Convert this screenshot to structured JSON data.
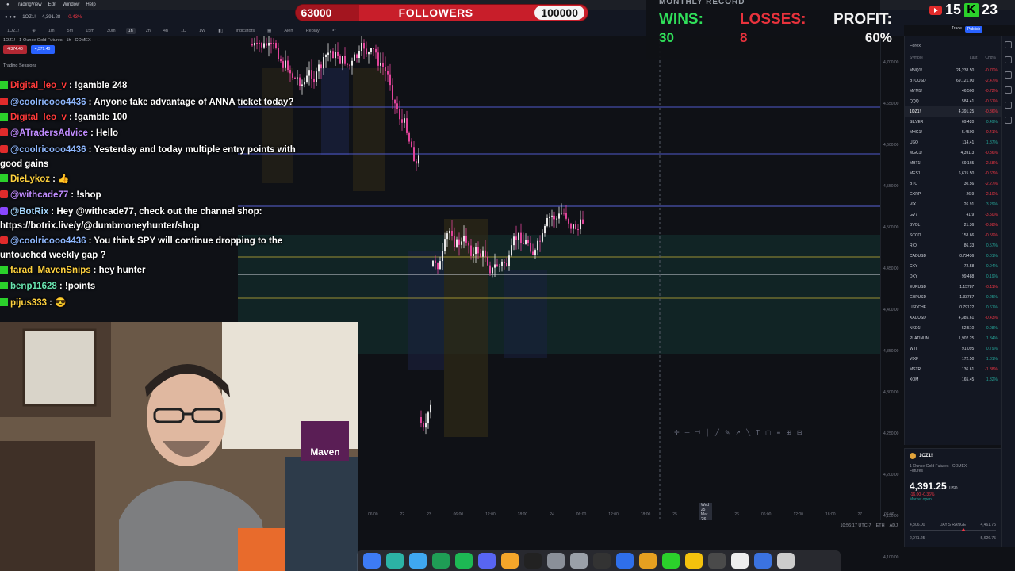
{
  "menubar": {
    "app": "TradingView",
    "items": [
      "Edit",
      "Window",
      "Help"
    ]
  },
  "tv": {
    "symbol": "1OZ1!",
    "price_bar": "4,391.28",
    "change_bar": "-0.43%",
    "description": "1OZ1! · 1-Ounce Gold Futures · 1h · COMEX",
    "indicators_label": "Indicators",
    "alert_label": "Alert",
    "replay_label": "Replay",
    "timeframes": [
      "1m",
      "5m",
      "15m",
      "30m",
      "1h",
      "2h",
      "4h",
      "1D",
      "1W"
    ],
    "active_timeframe": "1h",
    "sessions_label": "Trading Sessions",
    "sell_price": "4,374.40",
    "buy_price": "4,379.40",
    "publish_label": "Publish",
    "trade_label": "Trade"
  },
  "followers": {
    "min": "63000",
    "label": "FOLLOWERS",
    "max": "100000"
  },
  "record": {
    "title": "MONTHLY RECORD",
    "wins_label": "WINS:",
    "wins": "30",
    "losses_label": "LOSSES:",
    "losses": "8",
    "profit_label": "PROFIT:",
    "profit": "60%"
  },
  "live_counts": {
    "youtube": "15",
    "kick": "23",
    "kick_letter": "K"
  },
  "chat": [
    {
      "badge": "k",
      "user": "Digital_leo_v",
      "user_class": "u-red",
      "text": "!gamble 248"
    },
    {
      "badge": "y",
      "user": "@coolricooo4436",
      "user_class": "u-blue",
      "text": "Anyone take advantage of ANNA ticket today?"
    },
    {
      "badge": "k",
      "user": "Digital_leo_v",
      "user_class": "u-red",
      "text": "!gamble 100"
    },
    {
      "badge": "y",
      "user": "@ATradersAdvice",
      "user_class": "u-purple",
      "text": "Hello"
    },
    {
      "badge": "y",
      "user": "@coolricooo4436",
      "user_class": "u-blue",
      "text": "Yesterday and today multiple entry points with good gains"
    },
    {
      "badge": "k",
      "user": "DieLykoz",
      "user_class": "u-gold",
      "text": "👍"
    },
    {
      "badge": "y",
      "user": "@withcade77",
      "user_class": "u-purple",
      "text": "!shop"
    },
    {
      "badge": "t",
      "user": "@BotRix",
      "user_class": "u-cyan",
      "text": "Hey @withcade77, check out the channel shop: https://botrix.live/y/@dumbmoneyhunter/shop"
    },
    {
      "badge": "y",
      "user": "@coolricooo4436",
      "user_class": "u-blue",
      "text": "You think SPY will continue dropping to the untouched weekly gap ?"
    },
    {
      "badge": "k",
      "user": "farad_MavenSnips",
      "user_class": "u-gold",
      "text": "hey hunter"
    },
    {
      "badge": "k",
      "user": "benp11628",
      "user_class": "u-teal",
      "text": "!points"
    },
    {
      "badge": "k",
      "user": "pijus333",
      "user_class": "u-gold",
      "text": "😎"
    }
  ],
  "price_axis": [
    "4,700.00",
    "4,650.00",
    "4,600.00",
    "4,550.00",
    "4,500.00",
    "4,450.00",
    "4,400.00",
    "4,350.00",
    "4,300.00",
    "4,250.00",
    "4,200.00",
    "4,150.00",
    "4,100.00"
  ],
  "time_axis": [
    "06:00",
    "22",
    "23",
    "06:00",
    "12:00",
    "18:00",
    "24",
    "06:00",
    "12:00",
    "18:00",
    "25",
    "Wed 25 Mar '26 12:00",
    "26",
    "06:00",
    "12:00",
    "18:00",
    "27",
    "06:00",
    "28"
  ],
  "status_time": "10:56:17 UTC-7",
  "status_session": "ETH",
  "status_adj": "ADJ",
  "watchlist": {
    "title": "Forex",
    "headers": [
      "Symbol",
      "Last",
      "Chg%"
    ],
    "rows": [
      {
        "sym": "MNQ1!",
        "last": "24,238.50",
        "chg": "-0.70%",
        "dir": "down"
      },
      {
        "sym": "BTCUSD",
        "last": "69,121.00",
        "chg": "-2.47%",
        "dir": "down"
      },
      {
        "sym": "MYM1!",
        "last": "46,500",
        "chg": "-0.72%",
        "dir": "down"
      },
      {
        "sym": "QQQ",
        "last": "584.41",
        "chg": "-0.61%",
        "dir": "down"
      },
      {
        "sym": "1OZ1!",
        "last": "4,391.25",
        "chg": "-0.36%",
        "dir": "down",
        "sel": true
      },
      {
        "sym": "SILVER",
        "last": "69.420",
        "chg": "0.49%",
        "dir": "up"
      },
      {
        "sym": "MHG1!",
        "last": "5.4500",
        "chg": "-0.41%",
        "dir": "down"
      },
      {
        "sym": "USO",
        "last": "114.41",
        "chg": "1.87%",
        "dir": "up"
      },
      {
        "sym": "MGC1!",
        "last": "4,391.3",
        "chg": "-0.36%",
        "dir": "down"
      },
      {
        "sym": "MBT1!",
        "last": "69,165",
        "chg": "-2.58%",
        "dir": "down"
      },
      {
        "sym": "MES1!",
        "last": "6,615.50",
        "chg": "-0.63%",
        "dir": "down"
      },
      {
        "sym": "BTC",
        "last": "30.56",
        "chg": "-2.27%",
        "dir": "down"
      },
      {
        "sym": "GXRP",
        "last": "26.9",
        "chg": "-2.10%",
        "dir": "down"
      },
      {
        "sym": "VIX",
        "last": "26.91",
        "chg": "3.29%",
        "dir": "up"
      },
      {
        "sym": "GV7",
        "last": "41.9",
        "chg": "-3.50%",
        "dir": "down"
      },
      {
        "sym": "BVOL",
        "last": "21.36",
        "chg": "-0.98%",
        "dir": "down"
      },
      {
        "sym": "SCCO",
        "last": "158.66",
        "chg": "-0.59%",
        "dir": "down"
      },
      {
        "sym": "RIO",
        "last": "86.33",
        "chg": "0.57%",
        "dir": "up"
      },
      {
        "sym": "CADUSD",
        "last": "0.72436",
        "chg": "0.01%",
        "dir": "up"
      },
      {
        "sym": "CXY",
        "last": "72.58",
        "chg": "0.04%",
        "dir": "up"
      },
      {
        "sym": "DXY",
        "last": "99.488",
        "chg": "0.19%",
        "dir": "up"
      },
      {
        "sym": "EURUSD",
        "last": "1.15787",
        "chg": "-0.11%",
        "dir": "down"
      },
      {
        "sym": "GBPUSD",
        "last": "1.33787",
        "chg": "0.25%",
        "dir": "up"
      },
      {
        "sym": "USDCHF",
        "last": "0.79122",
        "chg": "0.61%",
        "dir": "up"
      },
      {
        "sym": "XAUUSD",
        "last": "4,385.61",
        "chg": "-0.43%",
        "dir": "down"
      },
      {
        "sym": "NKD1!",
        "last": "52,510",
        "chg": "0.08%",
        "dir": "up"
      },
      {
        "sym": "PLATINUM",
        "last": "1,902.25",
        "chg": "1.34%",
        "dir": "up"
      },
      {
        "sym": "WTI",
        "last": "91.095",
        "chg": "0.79%",
        "dir": "up"
      },
      {
        "sym": "VIXF",
        "last": "172.50",
        "chg": "1.81%",
        "dir": "up"
      },
      {
        "sym": "MSTR",
        "last": "136.61",
        "chg": "-1.88%",
        "dir": "down"
      },
      {
        "sym": "XOM",
        "last": "165.45",
        "chg": "1.32%",
        "dir": "up"
      }
    ]
  },
  "details": {
    "ticker": "1OZ1!",
    "name": "1-Ounce Gold Futures · COMEX",
    "type": "Futures",
    "price": "4,391.25",
    "unit": "USD",
    "change": "-16.00  -0.36%",
    "status": "Market open",
    "low": "4,306.00",
    "range_label": "DAY'S RANGE",
    "high": "4,461.75",
    "low2": "2,971.25",
    "high2": "5,626.75"
  },
  "cam_sign": "Maven",
  "colors": {
    "up": "#26a69a",
    "down": "#f23645",
    "followers_red": "#c81e2a",
    "wins_green": "#30e05a",
    "losses_red": "#e8323c"
  }
}
